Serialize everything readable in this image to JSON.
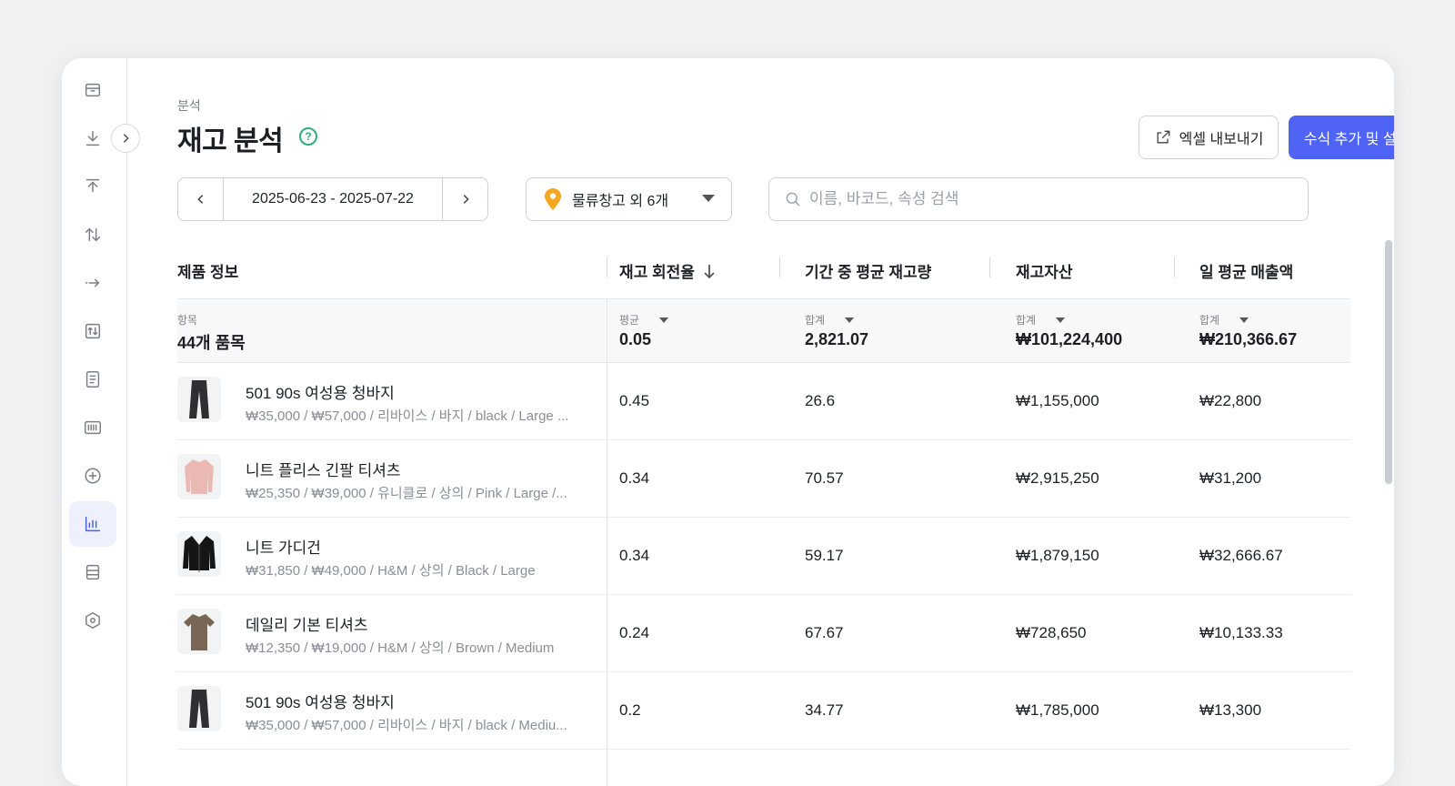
{
  "sidebar": {
    "items": [
      {
        "name": "inventory-box-icon"
      },
      {
        "name": "inbound-icon"
      },
      {
        "name": "outbound-icon"
      },
      {
        "name": "transfer-icon"
      },
      {
        "name": "move-icon"
      },
      {
        "name": "adjust-icon"
      },
      {
        "name": "document-icon"
      },
      {
        "name": "barcode-icon"
      },
      {
        "name": "add-circle-icon"
      },
      {
        "name": "analytics-chart-icon",
        "active": true
      },
      {
        "name": "database-icon"
      },
      {
        "name": "settings-icon"
      }
    ]
  },
  "header": {
    "breadcrumb": "분석",
    "title": "재고 분석",
    "help_icon": "?",
    "export_label": "엑셀 내보내기",
    "primary_label": "수식 추가 및 설정"
  },
  "filters": {
    "date_range": "2025-06-23 - 2025-07-22",
    "warehouse": "물류창고 외 6개",
    "search_placeholder": "이름, 바코드, 속성 검색"
  },
  "table": {
    "columns": [
      "제품 정보",
      "재고 회전율",
      "기간 중 평균 재고량",
      "재고자산",
      "일 평균 매출액"
    ],
    "summary": {
      "item_label": "항목",
      "item_value": "44개 품목",
      "aggregations": [
        {
          "label": "평균",
          "value": "0.05"
        },
        {
          "label": "합계",
          "value": "2,821.07"
        },
        {
          "label": "합계",
          "value": "₩101,224,400"
        },
        {
          "label": "합계",
          "value": "₩210,366.67"
        }
      ]
    },
    "rows": [
      {
        "name": "501 90s 여성용 청바지",
        "meta": "₩35,000 / ₩57,000 / 리바이스 / 바지 / black / Large ...",
        "turnover": "0.45",
        "avg_stock": "26.6",
        "asset": "₩1,155,000",
        "daily_sales": "₩22,800",
        "thumb": "jeans",
        "color": "#2e2f33"
      },
      {
        "name": "니트 플리스 긴팔 티셔츠",
        "meta": "₩25,350 / ₩39,000 / 유니클로 / 상의 / Pink / Large /...",
        "turnover": "0.34",
        "avg_stock": "70.57",
        "asset": "₩2,915,250",
        "daily_sales": "₩31,200",
        "thumb": "longsleeve",
        "color": "#eab9b3"
      },
      {
        "name": "니트 가디건",
        "meta": "₩31,850 / ₩49,000 / H&M / 상의 / Black / Large",
        "turnover": "0.34",
        "avg_stock": "59.17",
        "asset": "₩1,879,150",
        "daily_sales": "₩32,666.67",
        "thumb": "cardigan",
        "color": "#151515"
      },
      {
        "name": "데일리 기본 티셔츠",
        "meta": "₩12,350 / ₩19,000 / H&M / 상의 / Brown / Medium",
        "turnover": "0.24",
        "avg_stock": "67.67",
        "asset": "₩728,650",
        "daily_sales": "₩10,133.33",
        "thumb": "tshirt",
        "color": "#7a6655"
      },
      {
        "name": "501 90s 여성용 청바지",
        "meta": "₩35,000 / ₩57,000 / 리바이스 / 바지 / black / Mediu...",
        "turnover": "0.2",
        "avg_stock": "34.77",
        "asset": "₩1,785,000",
        "daily_sales": "₩13,300",
        "thumb": "jeans",
        "color": "#2e2f33"
      }
    ]
  },
  "colors": {
    "accent": "#4f63f5",
    "help": "#2fae7a",
    "pin": "#f5a623"
  }
}
